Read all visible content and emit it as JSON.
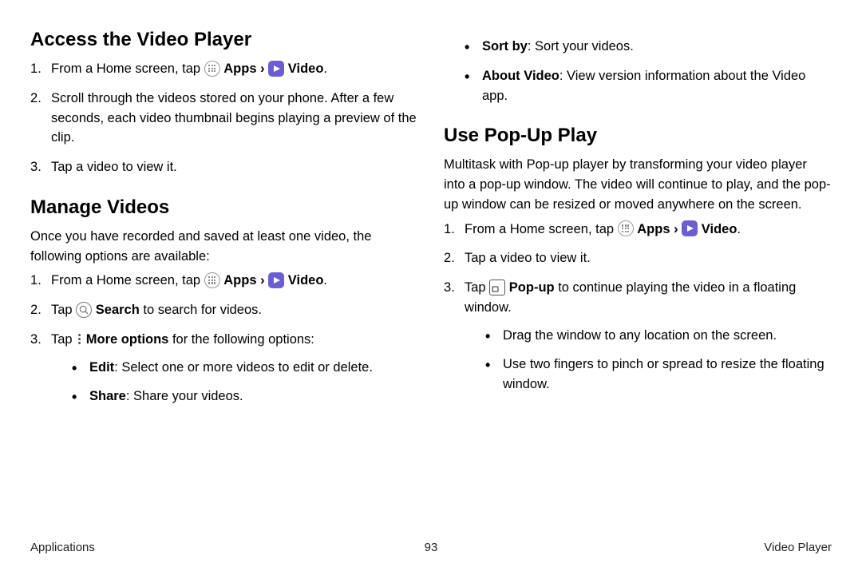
{
  "left": {
    "h1": "Access the Video Player",
    "s1_step1_a": "From a Home screen, tap ",
    "s1_step1_apps": "Apps",
    "s1_step1_chev": " › ",
    "s1_step1_video": "Video",
    "s1_step1_end": ".",
    "s1_step2": "Scroll through the videos stored on your phone. After a few seconds, each video thumbnail begins playing a preview of the clip.",
    "s1_step3": "Tap a video to view it.",
    "h2": "Manage Videos",
    "s2_intro": "Once you have recorded and saved at least one video, the following options are available:",
    "s2_step1_a": "From a Home screen, tap ",
    "s2_step1_apps": "Apps",
    "s2_step1_chev": " › ",
    "s2_step1_video": "Video",
    "s2_step1_end": ".",
    "s2_step2_a": "Tap ",
    "s2_step2_search": "Search",
    "s2_step2_b": " to search for videos.",
    "s2_step3_a": "Tap ",
    "s2_step3_more": "More options",
    "s2_step3_b": " for the following options:",
    "opt_edit_b": "Edit",
    "opt_edit_t": ": Select one or more videos to edit or delete.",
    "opt_share_b": "Share",
    "opt_share_t": ": Share your videos."
  },
  "right": {
    "opt_sort_b": "Sort by",
    "opt_sort_t": ": Sort your videos.",
    "opt_about_b": "About Video",
    "opt_about_t": ": View version information about the Video app.",
    "h3": "Use Pop-Up Play",
    "s3_intro": "Multitask with Pop-up player by transforming your video player into a pop-up window. The video will continue to play, and the pop-up window can be resized or moved anywhere on the screen.",
    "s3_step1_a": "From a Home screen, tap ",
    "s3_step1_apps": "Apps",
    "s3_step1_chev": " › ",
    "s3_step1_video": "Video",
    "s3_step1_end": ".",
    "s3_step2": "Tap a video to view it.",
    "s3_step3_a": "Tap ",
    "s3_step3_popup": "Pop-up",
    "s3_step3_b": " to continue playing the video in a floating window.",
    "sub1": "Drag the window to any location on the screen.",
    "sub2": "Use two fingers to pinch or spread to resize the floating window."
  },
  "footer": {
    "left": "Applications",
    "page": "93",
    "right": "Video Player"
  }
}
